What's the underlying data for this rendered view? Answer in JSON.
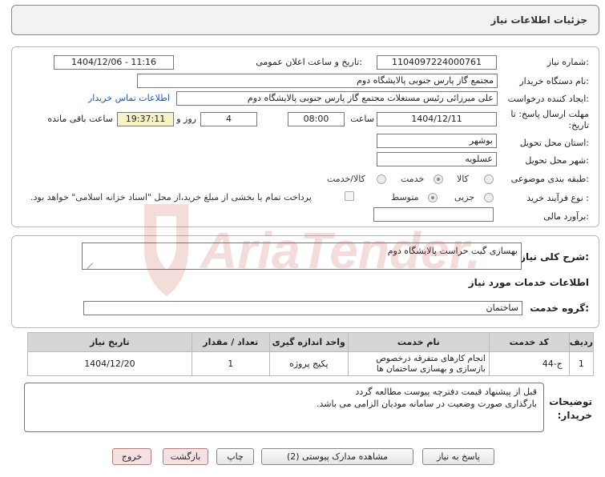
{
  "header": {
    "title": "جزئیات اطلاعات نیاز"
  },
  "form": {
    "need_number_label": "شماره نیاز:",
    "need_number": "1104097224000761",
    "announce_label": "تاریخ و ساعت اعلان عمومی:",
    "announce_value": "1404/12/06 - 11:16",
    "buyer_org_label": "نام دستگاه خریدار:",
    "buyer_org": "مجتمع گاز پارس جنوبی  پالایشگاه دوم",
    "creator_label": "ایجاد کننده درخواست:",
    "creator": "علی میرزائی رئیس مستغلات مجتمع گاز پارس جنوبی  پالایشگاه دوم",
    "contact_link": "اطلاعات تماس خریدار",
    "deadline_label": "مهلت ارسال پاسخ: تا تاریخ:",
    "deadline_date": "1404/12/11",
    "time_label": "ساعت",
    "deadline_time": "08:00",
    "days_value": "4",
    "days_label": "روز و",
    "remaining_time": "19:37:11",
    "remaining_label": "ساعت باقی مانده",
    "province_label": "استان محل تحویل:",
    "province": "بوشهر",
    "city_label": "شهر محل تحویل:",
    "city": "عسلویه",
    "category_label": "طبقه بندی موضوعی:",
    "category_options": [
      "کالا",
      "خدمت",
      "کالا/خدمت"
    ],
    "process_label": "نوع فرآیند خرید :",
    "process_options": [
      "جزیی",
      "متوسط"
    ],
    "payment_note": "پرداخت تمام یا بخشی از مبلغ خرید،از محل \"اسناد خزانه اسلامی\" خواهد بود.",
    "financial_label": "برآورد مالی:",
    "financial_value": ""
  },
  "need": {
    "description_label": "شرح کلی نیاز:",
    "description": "بهسازی گیت حراست پالایشگاه دوم",
    "services_title": "اطلاعات خدمات مورد نیاز",
    "service_group_label": "گروه خدمت:",
    "service_group": "ساختمان"
  },
  "table": {
    "headers": [
      "ردیف",
      "کد خدمت",
      "نام خدمت",
      "واحد اندازه گیری",
      "تعداد / مقدار",
      "تاریخ نیاز"
    ],
    "rows": [
      [
        "1",
        "ج-44",
        "انجام کارهای متفرقه درخصوص بازسازی و بهسازی ساختمان ها",
        "پکیج پروژه",
        "1",
        "1404/12/20"
      ]
    ]
  },
  "buyer_notes": {
    "label": "توضیحات خریدار:",
    "line1": "قبل از پیشنهاد قیمت دفترچه پیوست مطالعه گردد",
    "line2": "بارگذاری صورت وضعیت در سامانه مودیان الزامی می باشد."
  },
  "buttons": {
    "reply": "پاسخ به نیاز",
    "attachments": "مشاهده مدارک پیوستی (2)",
    "print": "چاپ",
    "back": "بازگشت",
    "exit": "خروج"
  },
  "watermark": {
    "text": "AriaTender.neT"
  },
  "colors": {
    "link": "#1a55c8",
    "remaining_bg": "#f7f3c6",
    "header_bg": "#f2f2f2"
  }
}
